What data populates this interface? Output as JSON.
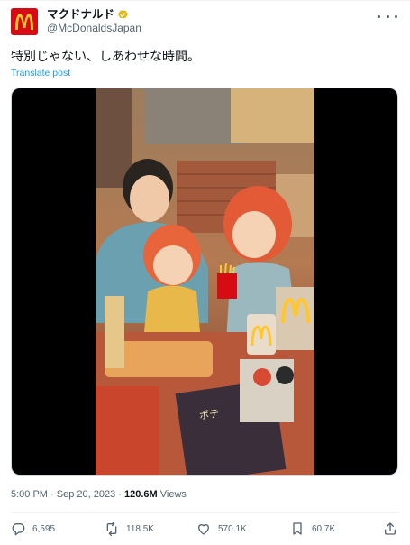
{
  "author": {
    "display_name": "マクドナルド",
    "handle": "@McDonaldsJapan",
    "avatar_icon": "mcdonalds-logo-icon",
    "verified_icon": "verified-badge-icon",
    "verified_color": "#e2b719",
    "brand_red": "#d60b14",
    "brand_yellow": "#ffc72c"
  },
  "tweet": {
    "text": "特別じゃない、しあわせな時間。",
    "translate_label": "Translate post"
  },
  "meta": {
    "time": "5:00 PM",
    "separator": "·",
    "date": "Sep 20, 2023",
    "views_count": "120.6M",
    "views_label": "Views"
  },
  "actions": {
    "reply_count": "6,595",
    "repost_count": "118.5K",
    "like_count": "570.1K",
    "bookmark_count": "60.7K"
  },
  "colors": {
    "text_primary": "#0f1419",
    "text_secondary": "#536471",
    "link": "#1d9bf0"
  }
}
